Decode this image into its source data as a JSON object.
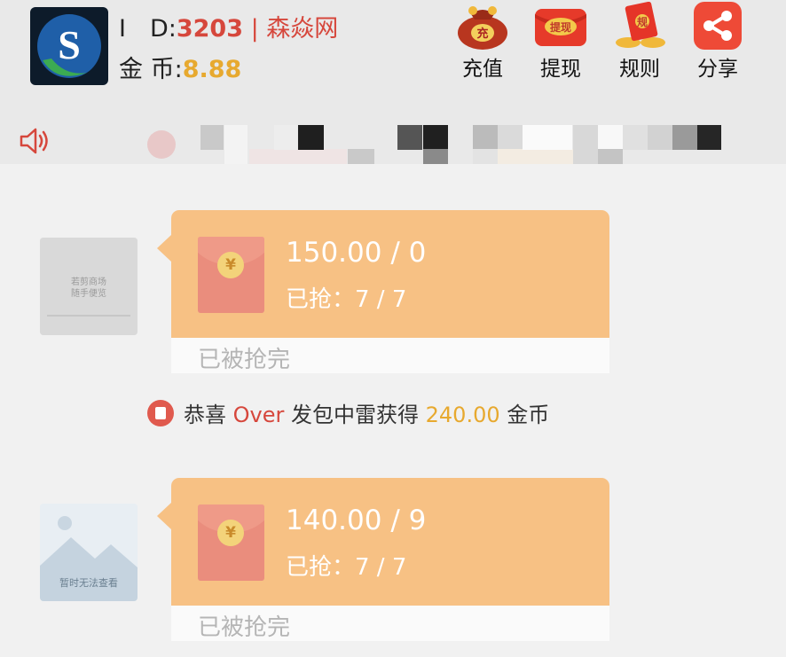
{
  "header": {
    "id_label": "I　D:",
    "id_value": "3203",
    "id_separator": " | ",
    "site_name": "森焱网",
    "coin_label": "金 币:",
    "coin_value": "8.88",
    "actions": [
      {
        "label": "充值",
        "icon": "money-bag-icon",
        "icon_text": "充"
      },
      {
        "label": "提现",
        "icon": "withdraw-red-packet-icon",
        "icon_text": "提现"
      },
      {
        "label": "规则",
        "icon": "rules-red-packet-icon",
        "icon_text": "规"
      },
      {
        "label": "分享",
        "icon": "share-icon"
      }
    ]
  },
  "notice": {
    "icon": "speaker-icon"
  },
  "messages": [
    {
      "avatar_icon": "avatar-placeholder",
      "avatar_text": [
        "若剪商场",
        "随手便览"
      ],
      "amount": "150.00 / 0",
      "grabbed": "已抢：7 / 7",
      "status": "已被抢完",
      "coin_symbol": "¥"
    },
    {
      "avatar_icon": "image-unavailable-icon",
      "avatar_text": [
        "暂时无法查看"
      ],
      "amount": "140.00 / 9",
      "grabbed": "已抢：7 / 7",
      "status": "已被抢完",
      "coin_symbol": "¥"
    }
  ],
  "system_message": {
    "prefix": "恭喜 ",
    "user": "Over",
    "middle": " 发包中雷获得 ",
    "amount": "240.00",
    "suffix": " 金币"
  },
  "colors": {
    "accent_red": "#d6473c",
    "gold": "#e7a92f",
    "bubble": "#f7c184",
    "envelope": "#ea8d7d"
  }
}
